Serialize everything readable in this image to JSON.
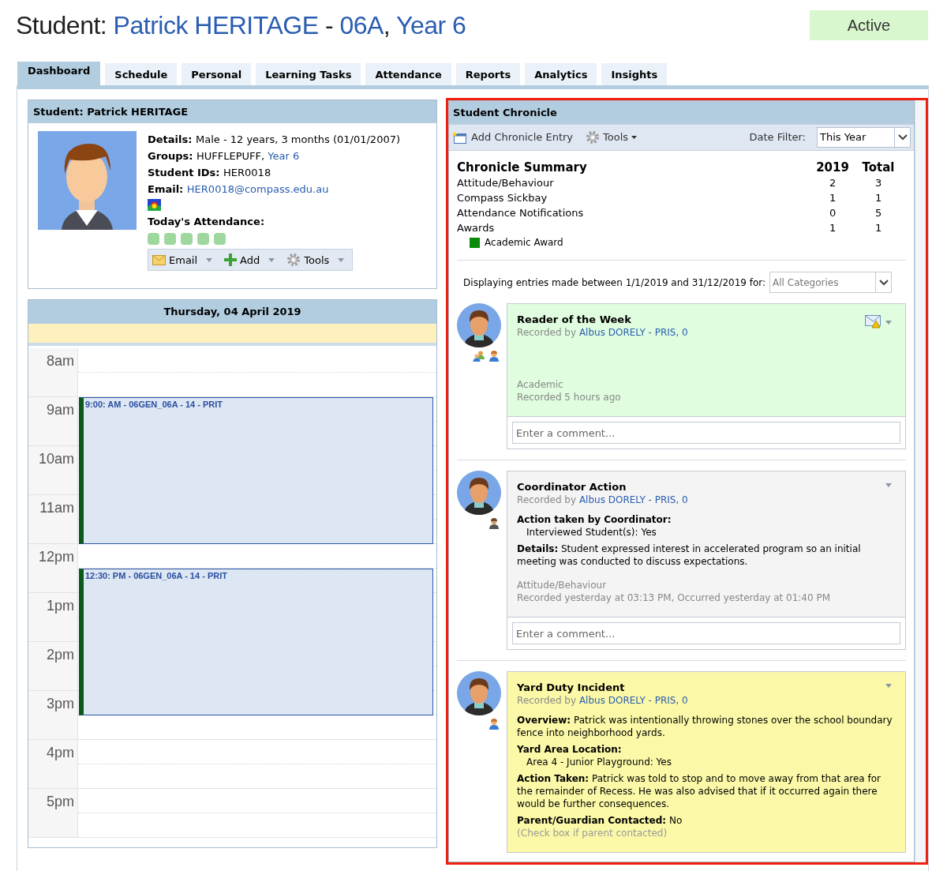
{
  "header": {
    "prefix": "Student:",
    "name": "Patrick HERITAGE",
    "separator": "-",
    "group": "06A",
    "comma": ",",
    "year": "Year 6",
    "status": "Active"
  },
  "tabs": [
    {
      "label": "Dashboard",
      "selected": true
    },
    {
      "label": "Schedule",
      "selected": false
    },
    {
      "label": "Personal",
      "selected": false
    },
    {
      "label": "Learning Tasks",
      "selected": false
    },
    {
      "label": "Attendance",
      "selected": false
    },
    {
      "label": "Reports",
      "selected": false
    },
    {
      "label": "Analytics",
      "selected": false
    },
    {
      "label": "Insights",
      "selected": false
    }
  ],
  "student_panel": {
    "title": "Student: Patrick HERITAGE",
    "details": [
      {
        "label": "Details:",
        "value": "Male - 12 years, 3 months (01/01/2007)",
        "kind": "text"
      },
      {
        "label": "Groups:",
        "value": "HUFFLEPUFF,",
        "link": "Year 6",
        "kind": "text"
      },
      {
        "label": "Student IDs:",
        "value": "HER0018",
        "kind": "text"
      },
      {
        "label": "Email:",
        "link": "HER0018@compass.edu.au",
        "kind": "link"
      }
    ],
    "attendance_label": "Today's Attendance:",
    "attendance": [
      {
        "kind": "present"
      },
      {
        "kind": "present"
      },
      {
        "kind": "present"
      },
      {
        "kind": "present"
      },
      {
        "kind": "present"
      }
    ],
    "actions": [
      {
        "label": "Email",
        "kind": "email"
      },
      {
        "label": "Add",
        "kind": "add"
      },
      {
        "label": "Tools",
        "kind": "tools"
      }
    ]
  },
  "calendar": {
    "title": "Thursday, 04 April 2019",
    "hours": [
      {
        "label": "8am"
      },
      {
        "label": "9am",
        "events": [
          {
            "label": "9:00: AM - 06GEN_06A - 14 - PRIT",
            "half_past": false
          }
        ]
      },
      {
        "label": "10am"
      },
      {
        "label": "11am"
      },
      {
        "label": "12pm",
        "events": [
          {
            "label": "12:30: PM - 06GEN_06A - 14 - PRIT",
            "half_past": true
          }
        ]
      },
      {
        "label": "1pm"
      },
      {
        "label": "2pm"
      },
      {
        "label": "3pm"
      },
      {
        "label": "4pm"
      },
      {
        "label": "5pm"
      }
    ]
  },
  "chronicle": {
    "title": "Student Chronicle",
    "add_label": "Add Chronicle Entry",
    "tools_label": "Tools",
    "date_filter_label": "Date Filter:",
    "date_filter_value": "This Year",
    "summary": {
      "title": "Chronicle Summary",
      "columns": [
        "2019",
        "Total"
      ],
      "rows": [
        {
          "label": "Attitude/Behaviour",
          "values": [
            "2",
            "3"
          ]
        },
        {
          "label": "Compass Sickbay",
          "values": [
            "1",
            "1"
          ]
        },
        {
          "label": "Attendance Notifications",
          "values": [
            "0",
            "5"
          ]
        },
        {
          "label": "Awards",
          "values": [
            "1",
            "1"
          ]
        }
      ],
      "legend": [
        {
          "label": "Academic Award",
          "color": "#0a8a0a"
        }
      ]
    },
    "range_text": "Displaying entries made between 1/1/2019 and 31/12/2019 for:",
    "category_filter": "All Categories",
    "entries": [
      {
        "title": "Reader of the Week",
        "recorded_prefix": "Recorded by",
        "recorded_by": "Albus DORELY - PRIS, 0",
        "color": "#e0fde0",
        "alert_icon": true,
        "badges": [
          {
            "kind": "group"
          },
          {
            "kind": "person"
          }
        ],
        "category": "Academic",
        "timestamp": "Recorded 5 hours ago",
        "comment_placeholder": "Enter a comment..."
      },
      {
        "title": "Coordinator Action",
        "recorded_prefix": "Recorded by",
        "recorded_by": "Albus DORELY - PRIS, 0",
        "color": "#f4f4f4",
        "alert_icon": false,
        "badges": [
          {
            "kind": "staff"
          }
        ],
        "fields": [
          {
            "kind": "block",
            "label": "Action taken by Coordinator:",
            "value": "Interviewed Student(s): Yes"
          },
          {
            "kind": "inline",
            "label": "Details:",
            "value": "Student expressed interest in accelerated program so an initial meeting was conducted to discuss expectations."
          }
        ],
        "category": "Attitude/Behaviour",
        "timestamp": "Recorded yesterday at 03:13 PM, Occurred yesterday at 01:40 PM",
        "comment_placeholder": "Enter a comment..."
      },
      {
        "title": "Yard Duty Incident",
        "recorded_prefix": "Recorded by",
        "recorded_by": "Albus DORELY - PRIS, 0",
        "color": "#fbf9a7",
        "alert_icon": false,
        "badges": [
          {
            "kind": "person"
          }
        ],
        "fields": [
          {
            "kind": "inline",
            "label": "Overview:",
            "value": "Patrick was intentionally throwing stones over the school boundary fence into neighborhood yards."
          },
          {
            "kind": "block",
            "label": "Yard Area Location:",
            "value": "Area 4 - Junior Playground: Yes"
          },
          {
            "kind": "inline",
            "label": "Action Taken:",
            "value": "Patrick was told to stop and to move away from that area for the remainder of Recess. He was also advised that if it occurred again there would be further consequences."
          },
          {
            "kind": "inline",
            "label": "Parent/Guardian Contacted:",
            "value": "No",
            "note": "(Check box if parent contacted)"
          }
        ]
      }
    ]
  }
}
